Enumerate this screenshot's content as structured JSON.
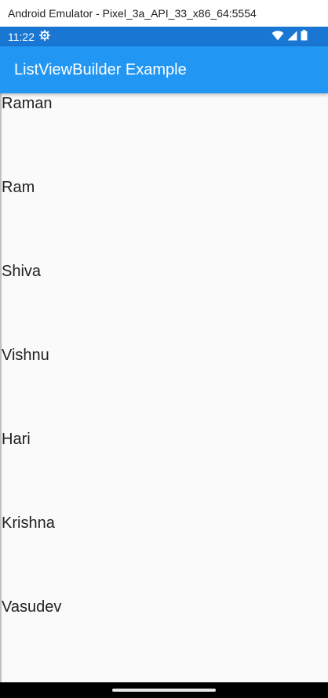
{
  "window": {
    "title": "Android Emulator - Pixel_3a_API_33_x86_64:5554"
  },
  "status_bar": {
    "time": "11:22",
    "icons": [
      "settings-gear-icon",
      "wifi-icon",
      "cellular-signal-icon",
      "battery-icon"
    ]
  },
  "app_bar": {
    "title": "ListViewBuilder Example"
  },
  "list": {
    "items": [
      {
        "label": "Raman"
      },
      {
        "label": "Ram"
      },
      {
        "label": "Shiva"
      },
      {
        "label": "Vishnu"
      },
      {
        "label": "Hari"
      },
      {
        "label": "Krishna"
      },
      {
        "label": "Vasudev"
      }
    ]
  },
  "colors": {
    "status_bar": "#1976d2",
    "app_bar": "#2196f3",
    "background": "#fafafa",
    "text": "#212121"
  }
}
